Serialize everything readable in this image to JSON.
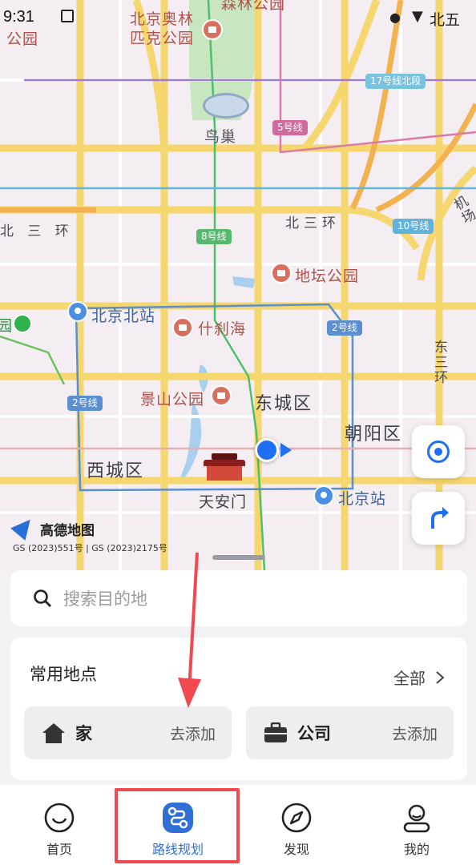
{
  "status_bar": {
    "time": "9:31",
    "right_text": "北五"
  },
  "map": {
    "districts": [
      "东城区",
      "朝阳区",
      "西城区"
    ],
    "roads": [
      "北三环",
      "北 三 环",
      "东三环",
      "机场"
    ],
    "pois": [
      "北京奥林匹克公园",
      "鸟巢",
      "地坛公园",
      "什刹海",
      "景山公园",
      "天安门",
      "北京北站",
      "北京站",
      "森林公园",
      "公园"
    ],
    "subway_badges": [
      "5号线",
      "8号线",
      "10号线",
      "2号线",
      "2号线",
      "17号线北段"
    ],
    "partial_labels": [
      "园"
    ],
    "logo_text": "高德地图",
    "copyright": "GS (2023)551号 | GS (2023)2175号"
  },
  "search": {
    "placeholder": "搜索目的地"
  },
  "favorites": {
    "title": "常用地点",
    "all_label": "全部",
    "home": {
      "name": "家",
      "action": "去添加"
    },
    "work": {
      "name": "公司",
      "action": "去添加"
    }
  },
  "tabs": [
    {
      "label": "首页"
    },
    {
      "label": "路线规划"
    },
    {
      "label": "发现"
    },
    {
      "label": "我的"
    }
  ],
  "colors": {
    "accent": "#2f6fd6",
    "annotation_red": "#f04a50"
  }
}
